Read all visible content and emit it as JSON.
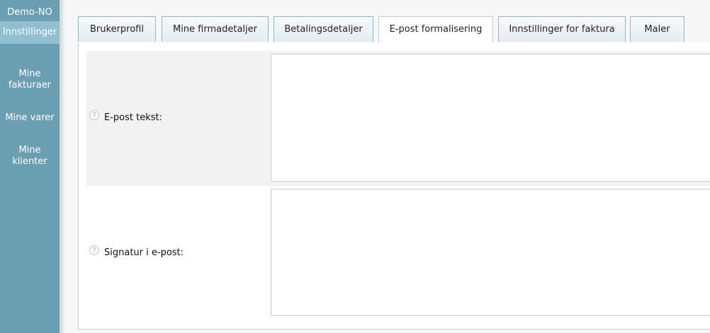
{
  "sidebar": {
    "company": "Demo-NO",
    "items": [
      {
        "label": "Innstillinger"
      },
      {
        "label": "Mine fakturaer"
      },
      {
        "label": "Mine varer"
      },
      {
        "label": "Mine klienter"
      }
    ]
  },
  "tabs": [
    {
      "label": "Brukerprofil"
    },
    {
      "label": "Mine firmadetaljer"
    },
    {
      "label": "Betalingsdetaljer"
    },
    {
      "label": "E-post formalisering"
    },
    {
      "label": "Innstillinger for faktura"
    },
    {
      "label": "Maler"
    }
  ],
  "active_tab": "E-post formalisering",
  "form": {
    "email_text_label": "E-post tekst:",
    "email_text_value": "",
    "signature_label": "Signatur i e-post:",
    "signature_value": ""
  },
  "icons": {
    "help": "question-circle-icon"
  },
  "colors": {
    "sidebar": "#6a9fb2",
    "sidebar_active": "#8fbfd0",
    "tab_border": "#8fb7c6"
  }
}
